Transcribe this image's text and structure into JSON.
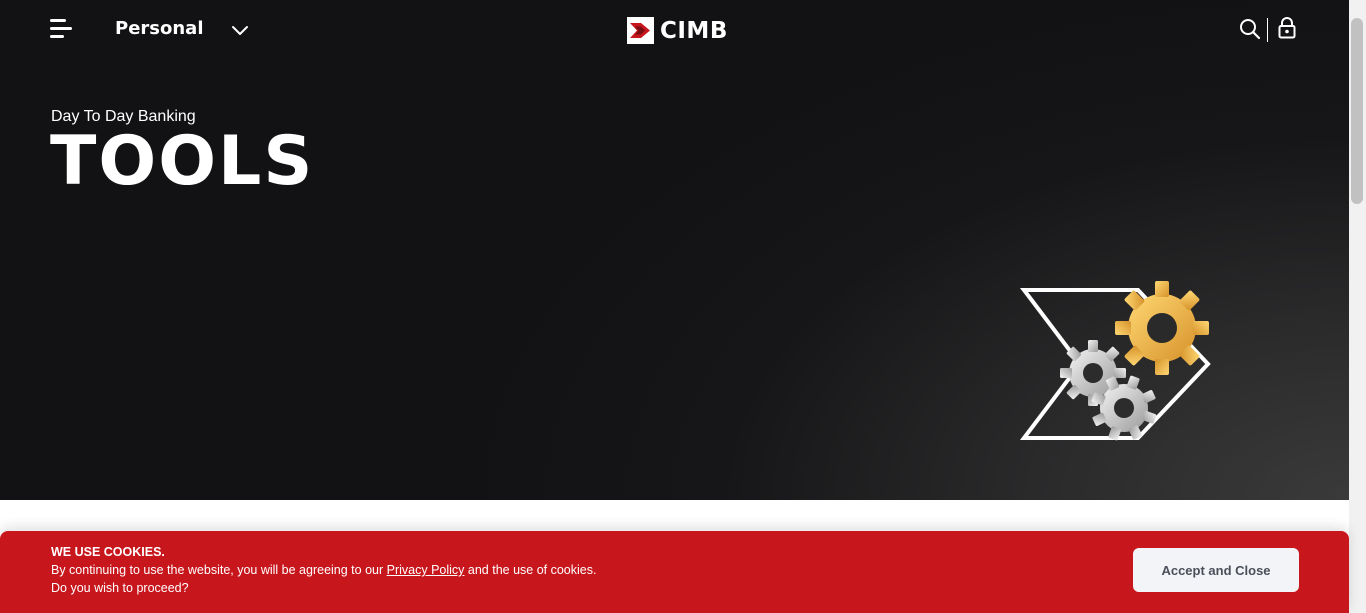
{
  "header": {
    "segment_label": "Personal",
    "brand_name": "CIMB",
    "brand_color": "#c8161d"
  },
  "hero": {
    "eyebrow": "Day To Day Banking",
    "title": "TOOLS",
    "illustration": "gears-icon"
  },
  "cookie_banner": {
    "heading": "WE USE COOKIES.",
    "text_before_link": "By continuing to use the website, you will be agreeing to our ",
    "link_text": "Privacy Policy",
    "text_after_link": " and the use of cookies.",
    "question": "Do you wish to proceed?",
    "accept_label": "Accept and Close",
    "background_color": "#c8161d"
  },
  "icons": {
    "menu": "menu-icon",
    "dropdown": "chevron-down-icon",
    "search": "search-icon",
    "lock": "lock-icon"
  }
}
